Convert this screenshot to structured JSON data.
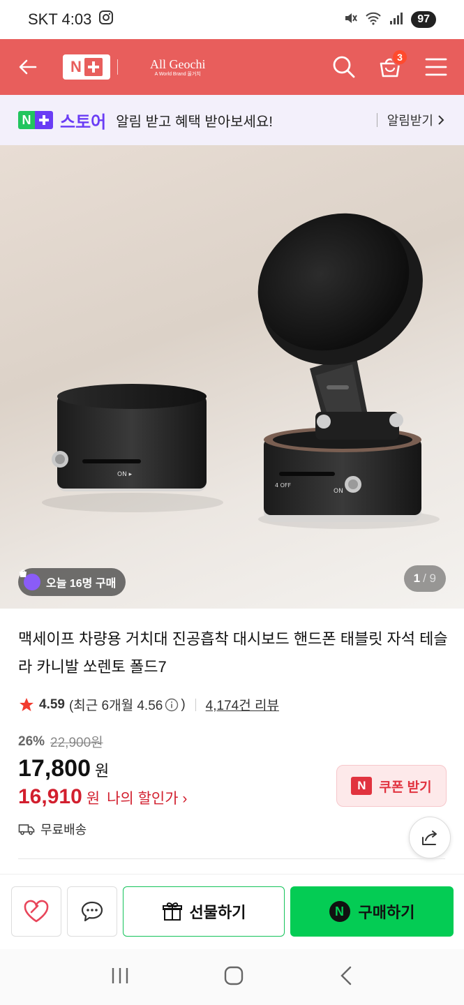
{
  "status_bar": {
    "carrier_time": "SKT 4:03",
    "battery": "97"
  },
  "header": {
    "brand_line1": "All Geochi",
    "brand_line2": "A World Brand 올거치",
    "cart_count": "3"
  },
  "notice": {
    "store_label": "스토어",
    "message": "알림 받고 혜택 받아보세요!",
    "action": "알림받기"
  },
  "gallery": {
    "buyers_today": "오늘 16명 구매",
    "current": "1",
    "total": "/ 9"
  },
  "product": {
    "title": "맥세이프 차량용 거치대 진공흡착 대시보드 핸드폰 태블릿 자석 테슬라 카니발 쏘렌토 폴드7",
    "rating": "4.59",
    "recent_rating": "(최근 6개월 4.56",
    "recent_rating_close": ")",
    "review_count": "4,174건 리뷰",
    "discount_pct": "26%",
    "original_price": "22,900원",
    "price": "17,800",
    "price_unit": "원",
    "my_price": "16,910",
    "my_price_unit": "원",
    "my_price_label": "나의 할인가 ›",
    "shipping": "무료배송",
    "coupon_label": "쿠폰 받기"
  },
  "action_bar": {
    "gift_label": "선물하기",
    "buy_label": "구매하기"
  },
  "colors": {
    "header_bg": "#e85e5c",
    "accent_green": "#04cc54",
    "sale_red": "#d21f2e",
    "store_purple": "#6a3cf5"
  }
}
